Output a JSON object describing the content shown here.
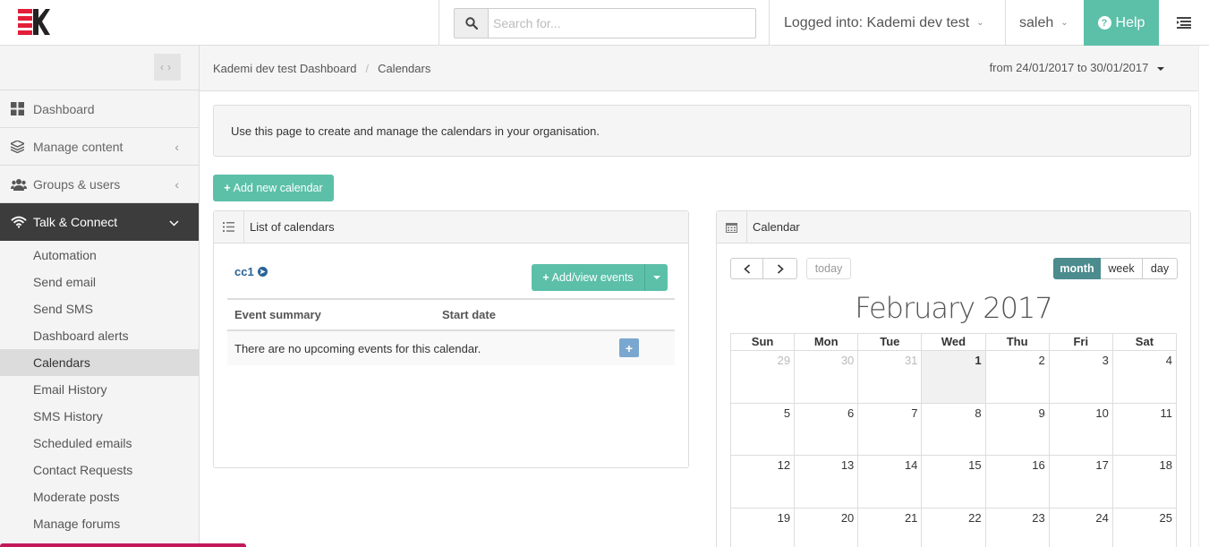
{
  "app": {
    "logo_icon": "kademi-logo"
  },
  "topbar": {
    "search_placeholder": "Search for...",
    "logged_into": "Logged into: Kademi dev test",
    "user": "saleh",
    "help": "Help"
  },
  "sidebar": {
    "main_items": [
      {
        "label": "Dashboard",
        "icon": "grid-icon"
      },
      {
        "label": "Manage content",
        "icon": "layers-icon"
      },
      {
        "label": "Groups & users",
        "icon": "users-icon"
      },
      {
        "label": "Talk & Connect",
        "icon": "wifi-icon",
        "active": true
      }
    ],
    "sub_items": [
      "Automation",
      "Send email",
      "Send SMS",
      "Dashboard alerts",
      "Calendars",
      "Email History",
      "SMS History",
      "Scheduled emails",
      "Contact Requests",
      "Moderate posts",
      "Manage forums"
    ],
    "selected_sub": "Calendars"
  },
  "breadcrumb": {
    "items": [
      "Kademi dev test Dashboard",
      "Calendars"
    ],
    "separator": "/",
    "date_range": "from 24/01/2017 to 30/01/2017"
  },
  "info_text": "Use this page to create and manage the calendars in your organisation.",
  "add_calendar_label": "Add new calendar",
  "list_panel": {
    "title": "List of calendars",
    "calendar_name": "cc1",
    "add_events_label": "Add/view events",
    "col_summary": "Event summary",
    "col_start": "Start date",
    "empty_message": "There are no upcoming events for this calendar."
  },
  "calendar_panel": {
    "title": "Calendar",
    "today_label": "today",
    "view_month": "month",
    "view_week": "week",
    "view_day": "day",
    "month_title": "February 2017",
    "days_of_week": [
      "Sun",
      "Mon",
      "Tue",
      "Wed",
      "Thu",
      "Fri",
      "Sat"
    ],
    "weeks": [
      [
        "29",
        "30",
        "31",
        "1",
        "2",
        "3",
        "4"
      ],
      [
        "5",
        "6",
        "7",
        "8",
        "9",
        "10",
        "11"
      ],
      [
        "12",
        "13",
        "14",
        "15",
        "16",
        "17",
        "18"
      ],
      [
        "19",
        "20",
        "21",
        "22",
        "23",
        "24",
        "25"
      ]
    ],
    "other_month_days": [
      "29",
      "30",
      "31"
    ],
    "today_day": "1"
  },
  "colors": {
    "accent": "#5cc0a9",
    "active_view": "#4c8b8e",
    "link": "#2a6496",
    "brand_red": "#e31e38"
  }
}
